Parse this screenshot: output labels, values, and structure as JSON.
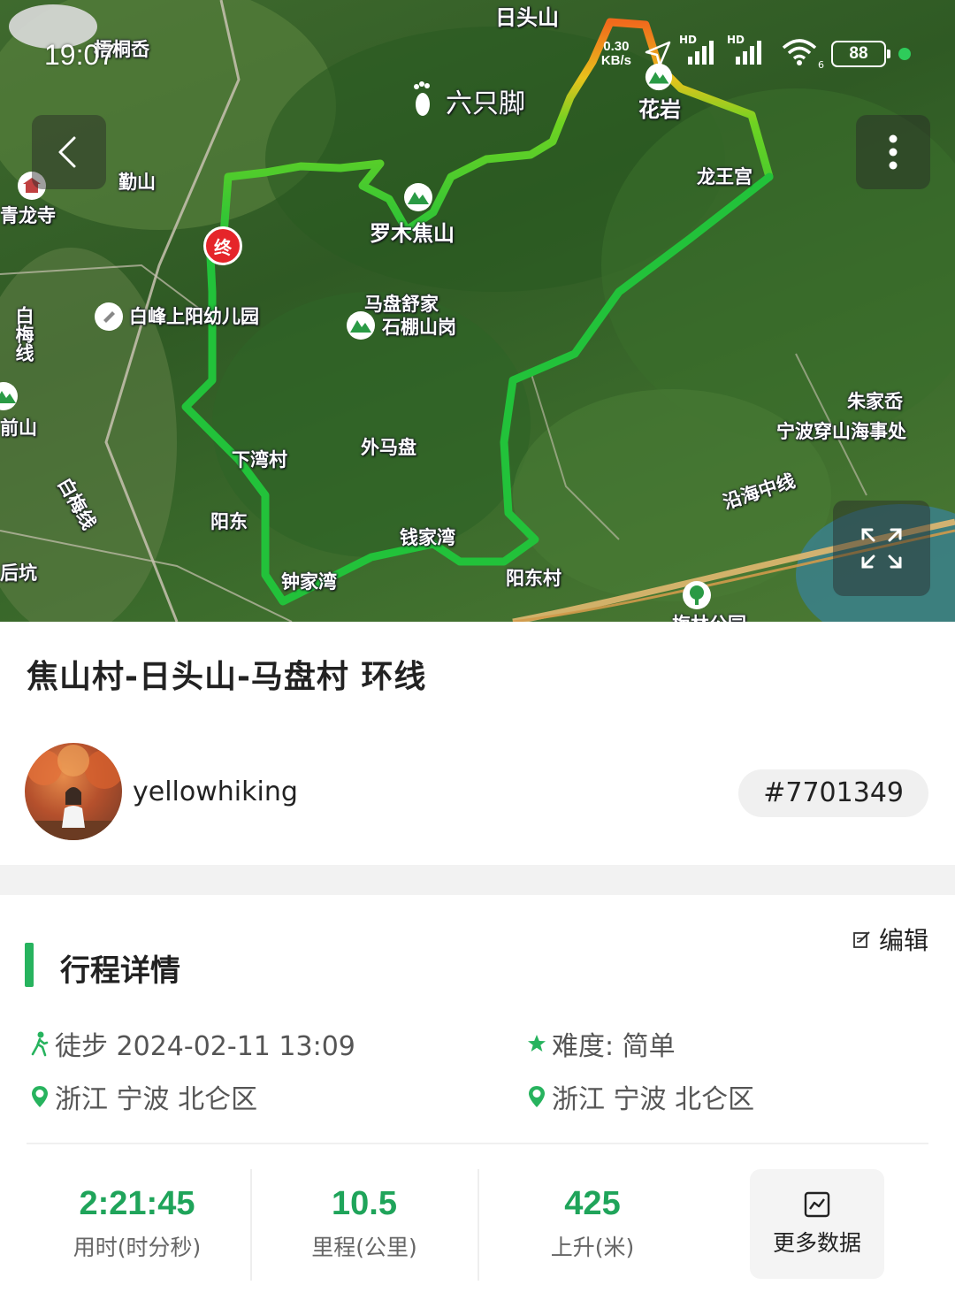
{
  "status_bar": {
    "time": "19:07",
    "net_speed_value": "0.30",
    "net_speed_unit": "KB/s",
    "hd1": "HD",
    "hd2": "HD",
    "wifi_num": "6",
    "battery": "88"
  },
  "map": {
    "labels": {
      "rts": "日头山",
      "hy": "花岩",
      "lsg": "龙王宫",
      "lzj": "六只脚",
      "qs": "勤山",
      "qls": "青龙寺",
      "jiaoshan": "罗木焦山",
      "mpsj": "马盘舒家",
      "smsg": "石棚山岗",
      "bfyey": "白峰上阳幼儿园",
      "wmp": "外马盘",
      "xwc": "下湾村",
      "yd": "阳东",
      "qjw": "钱家湾",
      "zjw": "钟家湾",
      "ydc": "阳东村",
      "zjs": "朱家岙",
      "nbcs": "宁波穿山海事处",
      "yhzx": "沿海中线",
      "qs2": "前山",
      "bmx": "白梅线",
      "bmx2": "白梅线",
      "hk": "后坑",
      "tree": "梅林公园",
      "hsq": "梧桐岙"
    },
    "end_marker": "终"
  },
  "route": {
    "title": "焦山村-日头山-马盘村 环线",
    "user": "yellowhiking",
    "id": "#7701349"
  },
  "details": {
    "section_title": "行程详情",
    "edit": "编辑",
    "activity": "徒步 2024-02-11 13:09",
    "difficulty": "难度: 简单",
    "start_location": "浙江 宁波 北仑区",
    "end_location": "浙江 宁波 北仑区"
  },
  "stats": {
    "duration": {
      "value": "2:21:45",
      "label": "用时(时分秒)"
    },
    "distance": {
      "value": "10.5",
      "label": "里程(公里)"
    },
    "ascent": {
      "value": "425",
      "label": "上升(米)"
    },
    "more": "更多数据"
  },
  "colors": {
    "accent_green": "#27b35e",
    "stat_green": "#1fa45a",
    "route_green": "#22c23a",
    "route_orange": "#f08a1c"
  }
}
